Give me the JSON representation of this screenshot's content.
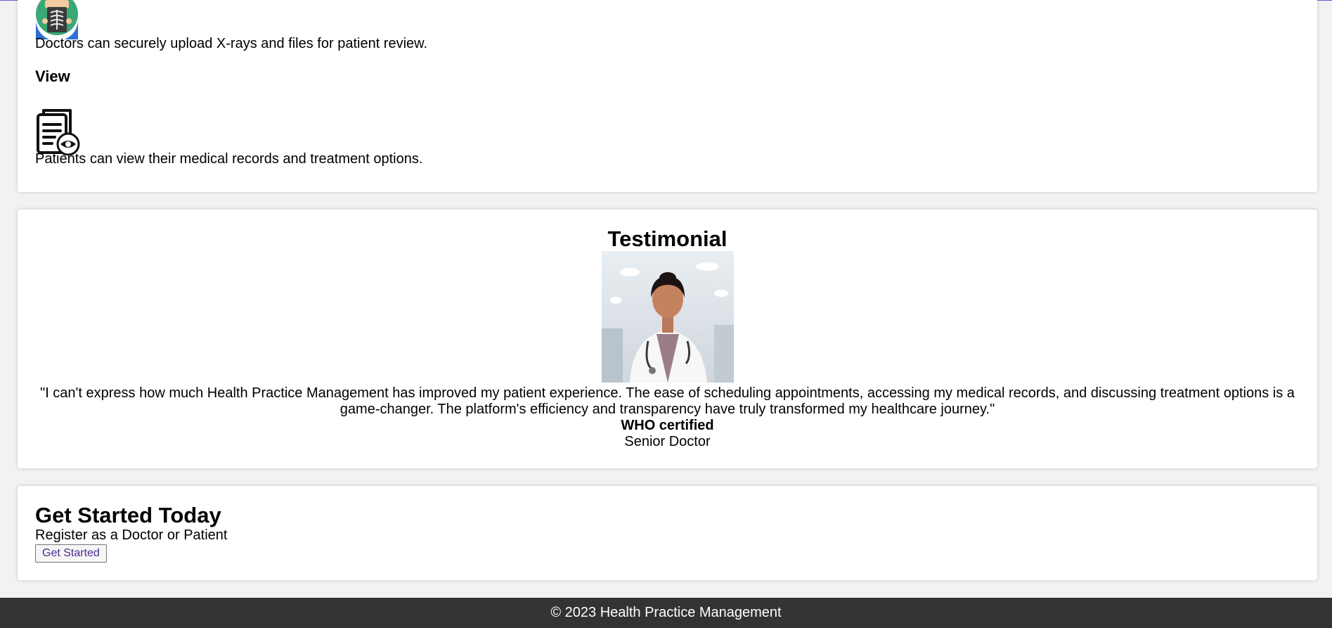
{
  "features": {
    "upload_description": "Doctors can securely upload X-rays and files for patient review.",
    "view_heading": "View",
    "view_description": "Patients can view their medical records and treatment options.",
    "upload_icon": "xray-icon",
    "view_icon": "records-eye-icon"
  },
  "testimonial": {
    "heading": "Testimonial",
    "quote": "\"I can't express how much Health Practice Management has improved my patient experience. The ease of scheduling appointments, accessing my medical records, and discussing treatment options is a game-changer. The platform's efficiency and transparency have truly transformed my healthcare journey.\"",
    "certification": "WHO certified",
    "role": "Senior Doctor"
  },
  "get_started": {
    "heading": "Get Started Today",
    "subtitle": "Register as a Doctor or Patient",
    "button_label": "Get Started",
    "button_color": "#4b2c8c"
  },
  "footer": {
    "copyright": "© 2023 Health Practice Management",
    "background": "#333333"
  }
}
